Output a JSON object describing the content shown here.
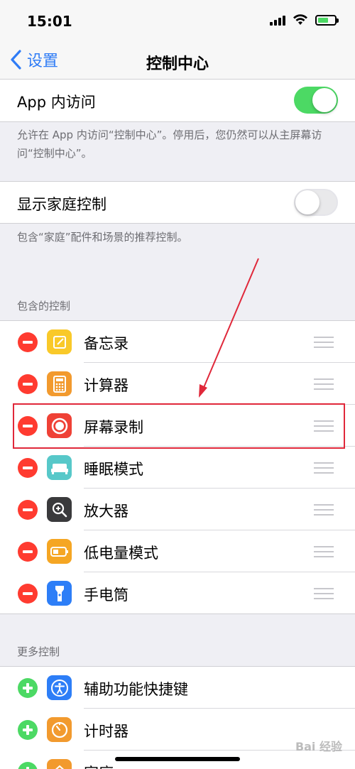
{
  "status": {
    "time": "15:01"
  },
  "nav": {
    "back_label": "设置",
    "title": "控制中心"
  },
  "access_in_apps": {
    "label": "App 内访问",
    "enabled": true,
    "footnote": "允许在 App 内访问“控制中心”。停用后，您仍然可以从主屏幕访问“控制中心”。"
  },
  "home_controls": {
    "label": "显示家庭控制",
    "enabled": false,
    "footnote": "包含“家庭”配件和场景的推荐控制。"
  },
  "included": {
    "header": "包含的控制",
    "items": [
      {
        "label": "备忘录",
        "icon": "notes-icon",
        "color": "#f9c929"
      },
      {
        "label": "计算器",
        "icon": "calculator-icon",
        "color": "#f29a2e"
      },
      {
        "label": "屏幕录制",
        "icon": "screen-recording-icon",
        "color": "#ef4136"
      },
      {
        "label": "睡眠模式",
        "icon": "bed-icon",
        "color": "#57c8c9"
      },
      {
        "label": "放大器",
        "icon": "magnifier-icon",
        "color": "#3a3a3c"
      },
      {
        "label": "低电量模式",
        "icon": "battery-icon",
        "color": "#f5a623"
      },
      {
        "label": "手电筒",
        "icon": "flashlight-icon",
        "color": "#2d7ef7"
      }
    ]
  },
  "more": {
    "header": "更多控制",
    "items": [
      {
        "label": "辅助功能快捷键",
        "icon": "accessibility-icon",
        "color": "#2d7ef7"
      },
      {
        "label": "计时器",
        "icon": "timer-icon",
        "color": "#f29a2e"
      },
      {
        "label": "家庭",
        "icon": "home-icon",
        "color": "#f29a2e"
      }
    ]
  },
  "colors": {
    "accent": "#2f7cf6",
    "toggle_on": "#4cd964",
    "remove": "#ff3b30",
    "annotation": "#e0283a"
  },
  "watermark": "Bai 经验"
}
